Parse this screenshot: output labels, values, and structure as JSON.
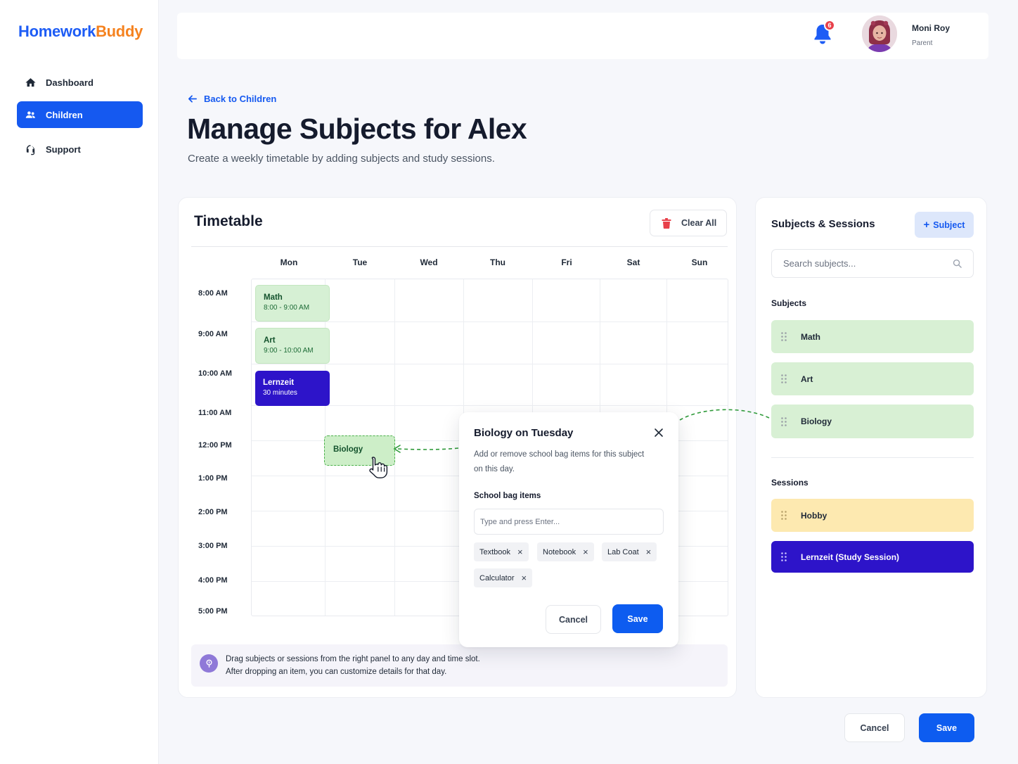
{
  "app": {
    "logo_part1": "Homework",
    "logo_part2": "Buddy"
  },
  "sidebar": {
    "items": [
      {
        "label": "Dashboard",
        "icon": "home-icon",
        "active": false
      },
      {
        "label": "Children",
        "icon": "users-icon",
        "active": true
      },
      {
        "label": "Support",
        "icon": "headset-icon",
        "active": false
      }
    ]
  },
  "header": {
    "notification_count": "6",
    "user_name": "Moni Roy",
    "user_role": "Parent"
  },
  "page": {
    "back_label": "Back to Children",
    "title": "Manage Subjects for Alex",
    "subtitle": "Create a weekly timetable by adding subjects and study sessions."
  },
  "timetable": {
    "title": "Timetable",
    "clear_all_label": "Clear All",
    "days": [
      "Mon",
      "Tue",
      "Wed",
      "Thu",
      "Fri",
      "Sat",
      "Sun"
    ],
    "times": [
      "8:00 AM",
      "9:00 AM",
      "10:00 AM",
      "11:00 AM",
      "12:00 PM",
      "1:00 PM",
      "2:00 PM",
      "3:00 PM",
      "4:00 PM",
      "5:00 PM"
    ],
    "events": [
      {
        "title": "Math",
        "detail": "8:00 - 9:00 AM",
        "day": "Mon",
        "color": "green"
      },
      {
        "title": "Art",
        "detail": "9:00 - 10:00 AM",
        "day": "Mon",
        "color": "green"
      },
      {
        "title": "Lernzeit",
        "detail": "30 minutes",
        "day": "Mon",
        "color": "indigo"
      }
    ],
    "dropped_item": {
      "title": "Biology",
      "day": "Tue",
      "time": "12:00 PM"
    },
    "hint_line1": "Drag subjects or sessions from the right panel to any day and time slot.",
    "hint_line2": "After dropping an item, you can customize details for that day."
  },
  "panel": {
    "title": "Subjects & Sessions",
    "add_label": "Subject",
    "search_placeholder": "Search subjects...",
    "subjects_heading": "Subjects",
    "subjects": [
      "Math",
      "Art",
      "Biology"
    ],
    "sessions_heading": "Sessions",
    "sessions": [
      {
        "label": "Hobby",
        "color": "yellow"
      },
      {
        "label": "Lernzeit (Study Session)",
        "color": "indigo"
      }
    ]
  },
  "popover": {
    "title": "Biology on Tuesday",
    "desc_line1": "Add or remove school bag items for this subject",
    "desc_line2": "on this day.",
    "items_label": "School bag items",
    "input_placeholder": "Type and press Enter...",
    "tags": [
      "Textbook",
      "Notebook",
      "Lab Coat",
      "Calculator"
    ],
    "cancel_label": "Cancel",
    "save_label": "Save"
  },
  "footer": {
    "cancel_label": "Cancel",
    "save_label": "Save"
  },
  "colors": {
    "primary": "#1559f0",
    "brand_orange": "#f5821f",
    "subject_green": "#d8f0d4",
    "session_yellow": "#fde9b0",
    "session_indigo": "#2d14c9",
    "danger": "#e8404a"
  }
}
